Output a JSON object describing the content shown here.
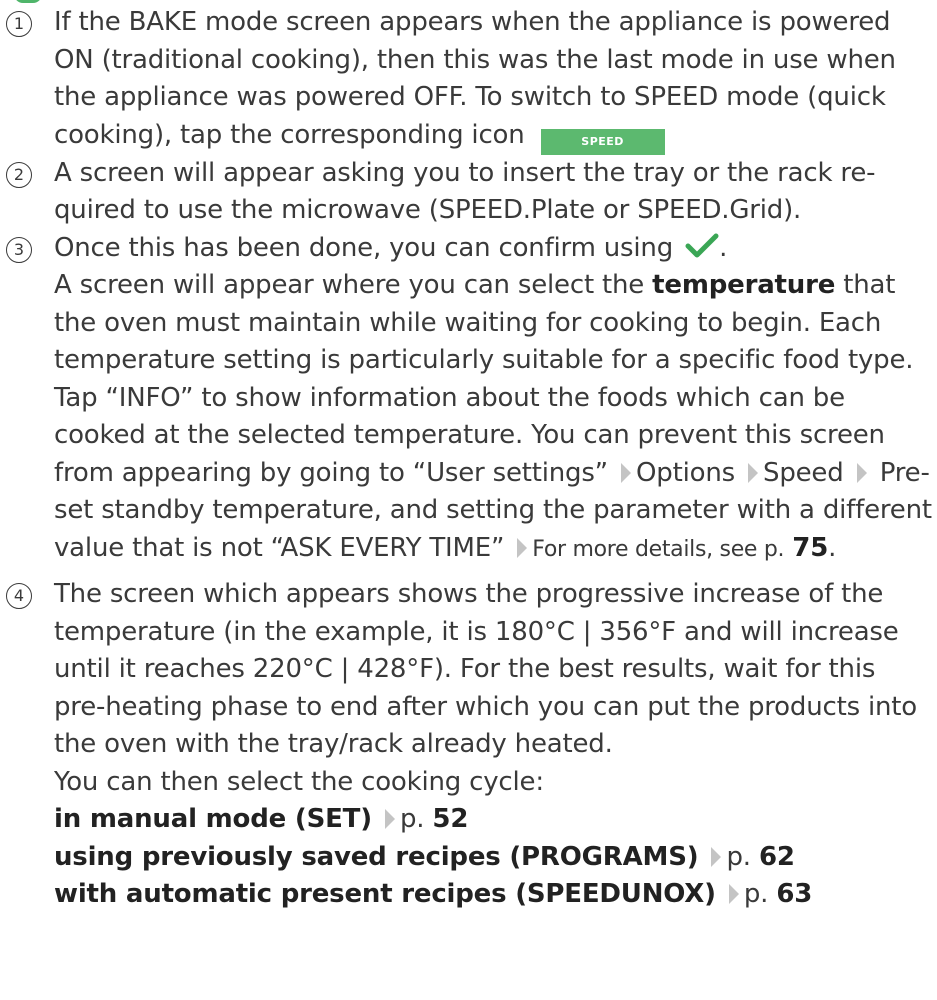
{
  "accent": "#5cb96f",
  "step1": {
    "num": "1",
    "text": "If the BAKE mode screen appears when the appliance is powered ON (traditional cooking), then this was the last mode in use when the appliance was powered OFF. To switch to SPEED mode (quick cooking), tap the corresponding icon",
    "icon_label": "SPEED"
  },
  "step2": {
    "num": "2",
    "text": "A screen will appear asking you to insert the tray or the rack re-quired to use the microwave (SPEED.Plate or SPEED.Grid)."
  },
  "step3": {
    "num": "3",
    "line1": "Once this has been done, you can confirm using",
    "line1_end": ".",
    "para_pre": "A screen will appear where you can select the",
    "para_bold": "temperature",
    "para_mid": "that the oven must maintain while waiting for cooking to begin. Each temperature setting is particularly suitable for a specific food type. Tap “INFO” to show information about the foods which can be cooked at the selected temperature. You can prevent this screen from appearing by going to “User settings”",
    "path1": "Options",
    "path2": "Speed",
    "path3": "Pre-set standby temperature, and setting the parameter with a different value that is not “ASK EVERY TIME”",
    "ref_text": "For more details, see p.",
    "ref_page": "75",
    "ref_end": "."
  },
  "step4": {
    "num": "4",
    "text": "The screen which appears shows the progressive increase of the temperature (in the example, it is 180°C | 356°F and will increase until it reaches 220°C | 428°F). For the best results, wait for this pre-heating phase to end after which you can put the products into the oven with the tray/rack already heated.",
    "select_text": "You can then select the cooking cycle:",
    "options": [
      {
        "label": "in manual mode (SET)",
        "p": "p.",
        "page": "52"
      },
      {
        "label": "using previously saved recipes (PROGRAMS)",
        "p": "p.",
        "page": "62"
      },
      {
        "label": "with automatic present recipes (SPEEDUNOX)",
        "p": "p.",
        "page": "63"
      }
    ]
  }
}
